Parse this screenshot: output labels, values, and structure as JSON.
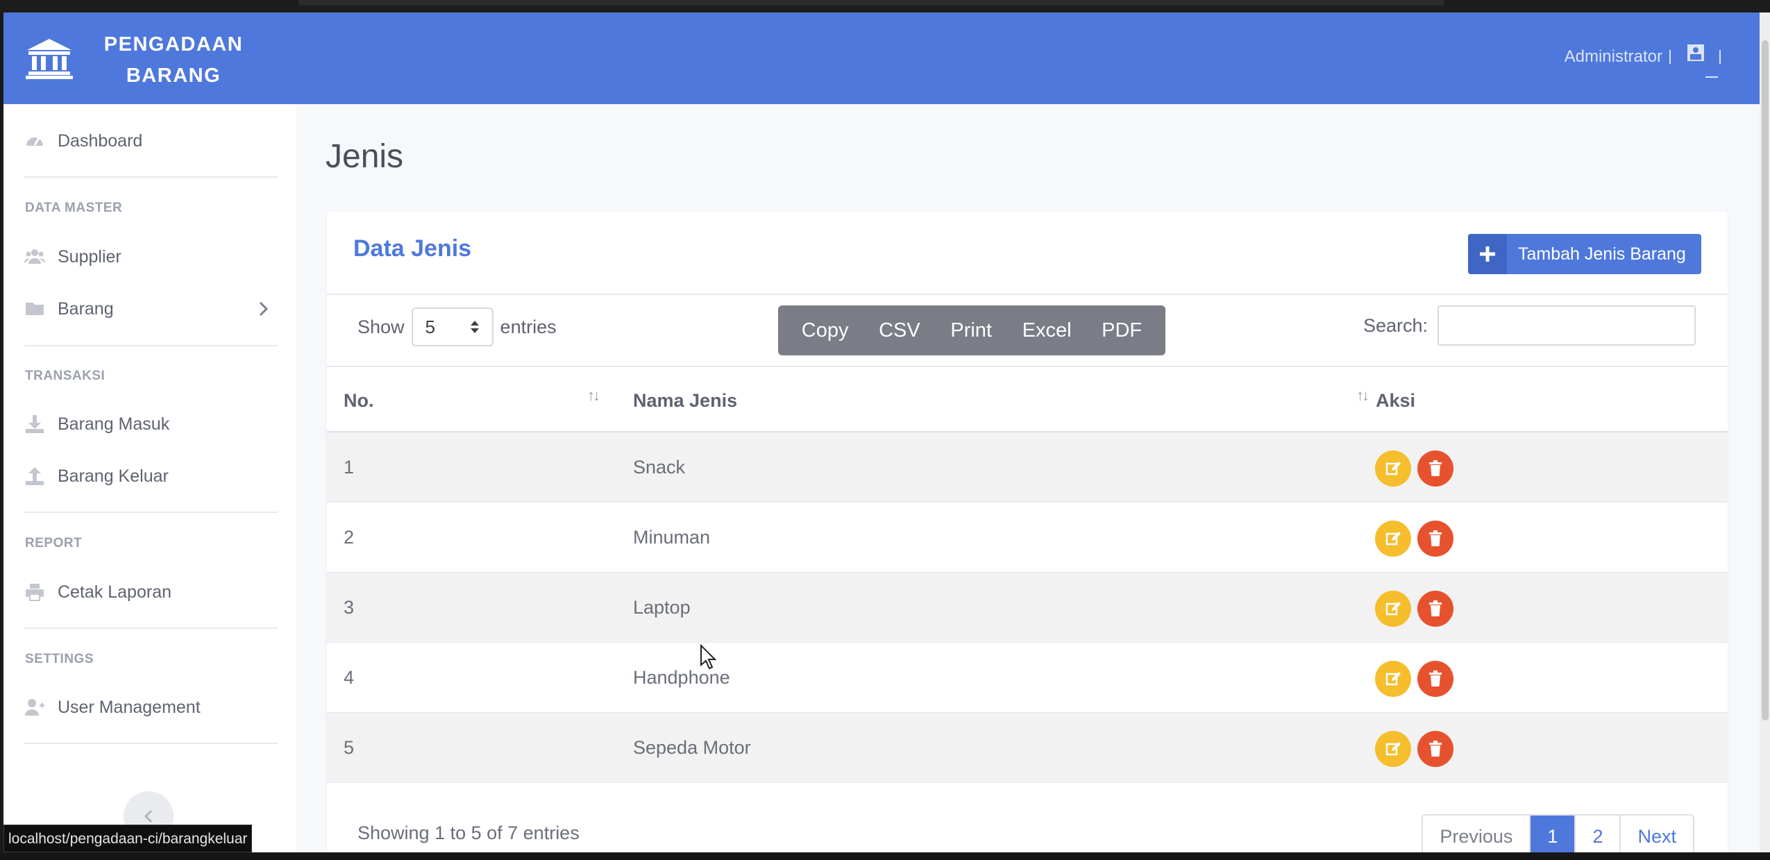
{
  "brand": {
    "title_line1": "PENGADAAN",
    "title_line2": "BARANG",
    "icon": "bank-icon"
  },
  "user": {
    "name": "Administrator",
    "avatar_icon": "user-avatar-icon"
  },
  "sidebar": {
    "dashboard": "Dashboard",
    "sections": {
      "data_master": "DATA MASTER",
      "transaksi": "TRANSAKSI",
      "report": "REPORT",
      "settings": "SETTINGS"
    },
    "items": {
      "supplier": "Supplier",
      "barang": "Barang",
      "barang_masuk": "Barang Masuk",
      "barang_keluar": "Barang Keluar",
      "cetak_laporan": "Cetak Laporan",
      "user_management": "User Management"
    }
  },
  "page": {
    "title": "Jenis"
  },
  "card": {
    "title": "Data Jenis",
    "add_button": "Tambah Jenis Barang",
    "show_label": "Show",
    "entries_label": "entries",
    "length_value": "5",
    "export_buttons": [
      "Copy",
      "CSV",
      "Print",
      "Excel",
      "PDF"
    ],
    "search_label": "Search:",
    "search_value": ""
  },
  "table": {
    "headers": {
      "no": "No.",
      "nama": "Nama Jenis",
      "aksi": "Aksi"
    },
    "rows": [
      {
        "no": "1",
        "nama": "Snack"
      },
      {
        "no": "2",
        "nama": "Minuman"
      },
      {
        "no": "3",
        "nama": "Laptop"
      },
      {
        "no": "4",
        "nama": "Handphone"
      },
      {
        "no": "5",
        "nama": "Sepeda Motor"
      }
    ]
  },
  "footer": {
    "info": "Showing 1 to 5 of 7 entries",
    "pager": {
      "previous": "Previous",
      "page1": "1",
      "page2": "2",
      "next": "Next"
    }
  },
  "status_url": "localhost/pengadaan-ci/barangkeluar",
  "colors": {
    "primary": "#4e78db",
    "edit": "#f6bd2c",
    "delete": "#e7522e",
    "export": "#7a7d86"
  }
}
